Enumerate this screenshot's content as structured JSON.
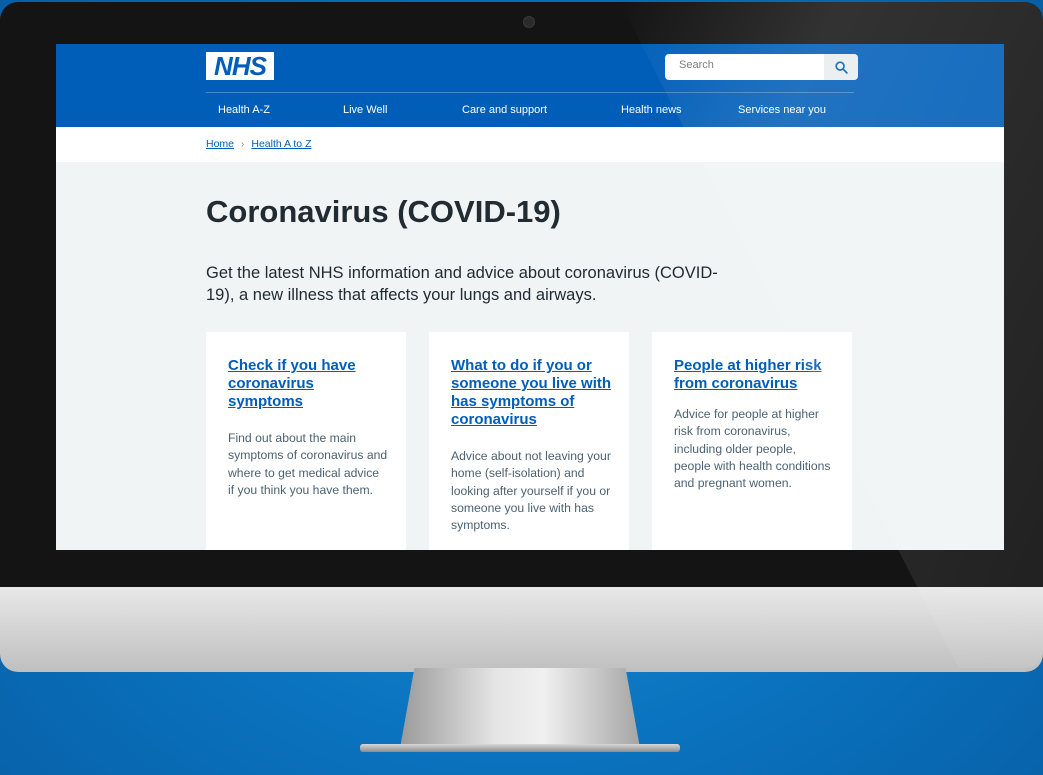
{
  "header": {
    "logo": "NHS",
    "search_placeholder": "Search",
    "nav": [
      "Health A-Z",
      "Live Well",
      "Care and support",
      "Health news",
      "Services near you"
    ]
  },
  "breadcrumb": {
    "items": [
      "Home",
      "Health A to Z"
    ],
    "separator": "›"
  },
  "page": {
    "title": "Coronavirus (COVID-19)",
    "lede": "Get the latest NHS information and advice about coronavirus (COVID-19), a new illness that affects your lungs and airways."
  },
  "cards": [
    {
      "title": "Check if you have coronavirus symptoms",
      "text": "Find out about the main symptoms of coronavirus and where to get medical advice if you think you have them."
    },
    {
      "title": "What to do if you or someone you live with has symptoms of coronavirus",
      "text": "Advice about not leaving your home (self-isolation) and looking after yourself if you or someone you live with has symptoms."
    },
    {
      "title": "People at higher risk from coronavirus",
      "text": "Advice for people at higher risk from coronavirus, including older people, people with health conditions and pregnant women."
    }
  ],
  "icons": {
    "search": "search-icon"
  },
  "colors": {
    "nhs_blue": "#005eb8",
    "background": "#f0f4f5",
    "text": "#212b32",
    "secondary_text": "#4c6272"
  }
}
